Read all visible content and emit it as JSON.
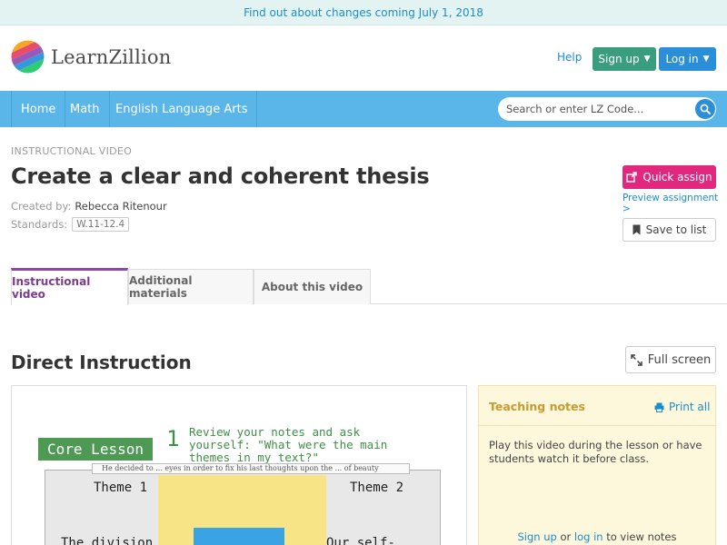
{
  "banner": {
    "text": "Find out about changes coming July 1, 2018"
  },
  "header": {
    "logo_text": "LearnZillion",
    "help_label": "Help",
    "signup_label": "Sign up",
    "login_label": "Log in"
  },
  "nav": {
    "items": [
      {
        "label": "Home"
      },
      {
        "label": "Math"
      },
      {
        "label": "English Language Arts"
      }
    ],
    "search_placeholder": "Search or enter LZ Code..."
  },
  "lesson": {
    "eyebrow": "INSTRUCTIONAL VIDEO",
    "title": "Create a clear and coherent thesis",
    "created_by_label": "Created by:",
    "created_by_value": "Rebecca Ritenour",
    "standards_label": "Standards:",
    "standards_value": "W.11-12.4",
    "quick_assign_label": "Quick assign",
    "preview_label": "Preview assignment >",
    "save_label": "Save to list"
  },
  "tabs": [
    {
      "label": "Instructional video",
      "active": true
    },
    {
      "label": "Additional materials",
      "active": false
    },
    {
      "label": "About this video",
      "active": false
    }
  ],
  "section": {
    "title": "Direct Instruction",
    "fullscreen_label": "Full screen"
  },
  "video": {
    "core_lesson": "Core Lesson",
    "step_number": "1",
    "step_text": "Review your notes and ask yourself: \"What were the main themes in my text?\"",
    "paper_text": "He decided to ... eyes in order to fix his last thoughts upon the ... of beauty",
    "theme1": "Theme 1",
    "theme2": "Theme 2",
    "handwriting1": "The division",
    "handwriting2": "Our self-"
  },
  "notes": {
    "title": "Teaching notes",
    "print_label": "Print all",
    "body": "Play this video during the lesson or have students watch it before class.",
    "signup_link": "Sign up",
    "or_text": "or",
    "login_link": "log in",
    "suffix_text": "to view notes"
  },
  "colors": {
    "nav_bg": "#5ab5e8",
    "signup_bg": "#3a9e7e",
    "login_bg": "#2a8fd8",
    "quick_assign_bg": "#e2287e",
    "active_tab": "#8e44ad",
    "notes_bg": "#fdf7dc",
    "notes_title": "#c99a2e",
    "link": "#1a8ec9"
  }
}
